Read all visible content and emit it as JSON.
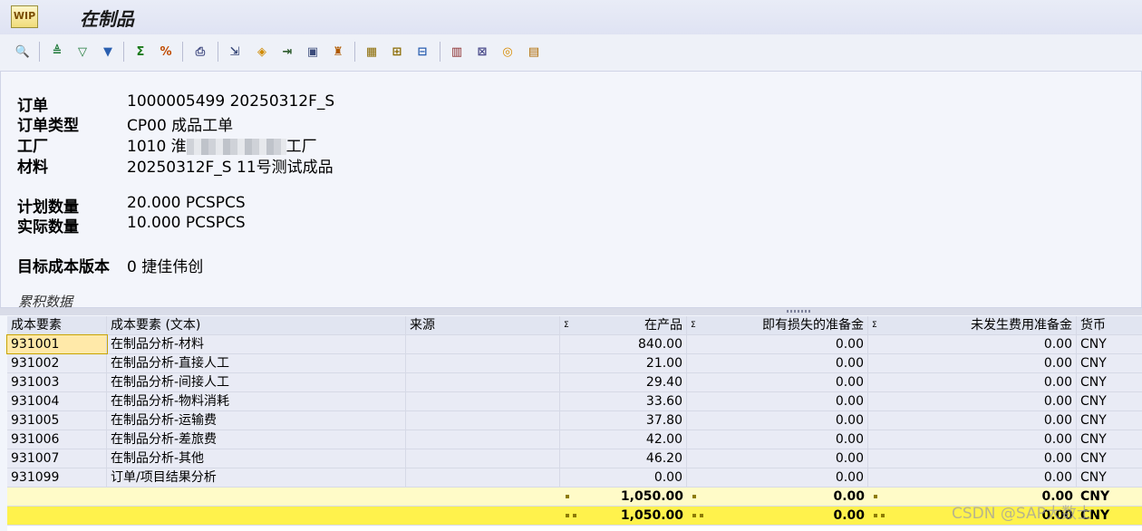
{
  "window": {
    "title": "在制品",
    "app_icon_label": "WIP"
  },
  "toolbar": {
    "icons": [
      "detail-icon",
      "sort-ascending-icon",
      "sort-descending-icon",
      "filter-icon",
      "sum-icon",
      "subtotal-icon",
      "print-preview-icon",
      "export-icon",
      "spreadsheet-icon",
      "local-file-icon",
      "word-processing-icon",
      "abc-analysis-icon",
      "layout-icon",
      "change-layout-icon",
      "save-layout-icon",
      "graphic-icon",
      "column-icon",
      "info-icon",
      "settings-icon"
    ]
  },
  "header": {
    "order_label": "订单",
    "order_value": "1000005499 20250312F_S",
    "order_type_label": "订单类型",
    "order_type_value": "CP00 成品工单",
    "plant_label": "工厂",
    "plant_value_prefix": "1010 淮",
    "plant_value_suffix": "工厂",
    "material_label": "材料",
    "material_value": "20250312F_S 11号测试成品",
    "plan_qty_label": "计划数量",
    "plan_qty_value": "20.000 PCSPCS",
    "actual_qty_label": "实际数量",
    "actual_qty_value": "10.000 PCSPCS",
    "target_cost_label": "目标成本版本",
    "target_cost_value": "0 捷佳伟创",
    "section_label": "累积数据"
  },
  "table": {
    "columns": [
      "成本要素",
      "成本要素 (文本)",
      "来源",
      "在产品",
      "即有损失的准备金",
      "未发生费用准备金",
      "货币"
    ],
    "sigma": "Σ",
    "rows": [
      {
        "element": "931001",
        "text": "在制品分析-材料",
        "source": "",
        "wip": "840.00",
        "loss": "0.00",
        "unincurred": "0.00",
        "currency": "CNY"
      },
      {
        "element": "931002",
        "text": "在制品分析-直接人工",
        "source": "",
        "wip": "21.00",
        "loss": "0.00",
        "unincurred": "0.00",
        "currency": "CNY"
      },
      {
        "element": "931003",
        "text": "在制品分析-间接人工",
        "source": "",
        "wip": "29.40",
        "loss": "0.00",
        "unincurred": "0.00",
        "currency": "CNY"
      },
      {
        "element": "931004",
        "text": "在制品分析-物料消耗",
        "source": "",
        "wip": "33.60",
        "loss": "0.00",
        "unincurred": "0.00",
        "currency": "CNY"
      },
      {
        "element": "931005",
        "text": "在制品分析-运输费",
        "source": "",
        "wip": "37.80",
        "loss": "0.00",
        "unincurred": "0.00",
        "currency": "CNY"
      },
      {
        "element": "931006",
        "text": "在制品分析-差旅费",
        "source": "",
        "wip": "42.00",
        "loss": "0.00",
        "unincurred": "0.00",
        "currency": "CNY"
      },
      {
        "element": "931007",
        "text": "在制品分析-其他",
        "source": "",
        "wip": "46.20",
        "loss": "0.00",
        "unincurred": "0.00",
        "currency": "CNY"
      },
      {
        "element": "931099",
        "text": "订单/项目结果分析",
        "source": "",
        "wip": "0.00",
        "loss": "0.00",
        "unincurred": "0.00",
        "currency": "CNY"
      }
    ],
    "subtotal": {
      "wip": "1,050.00",
      "loss": "0.00",
      "unincurred": "0.00",
      "currency": "CNY"
    },
    "total": {
      "wip": "1,050.00",
      "loss": "0.00",
      "unincurred": "0.00",
      "currency": "CNY"
    }
  },
  "watermark": "CSDN @SAP大数士",
  "colors": {
    "header_bg": "#e1e5f1",
    "subtotal_bg": "#fffbc8",
    "total_bg": "#fff24c",
    "selected_bg": "#ffe9a9"
  }
}
